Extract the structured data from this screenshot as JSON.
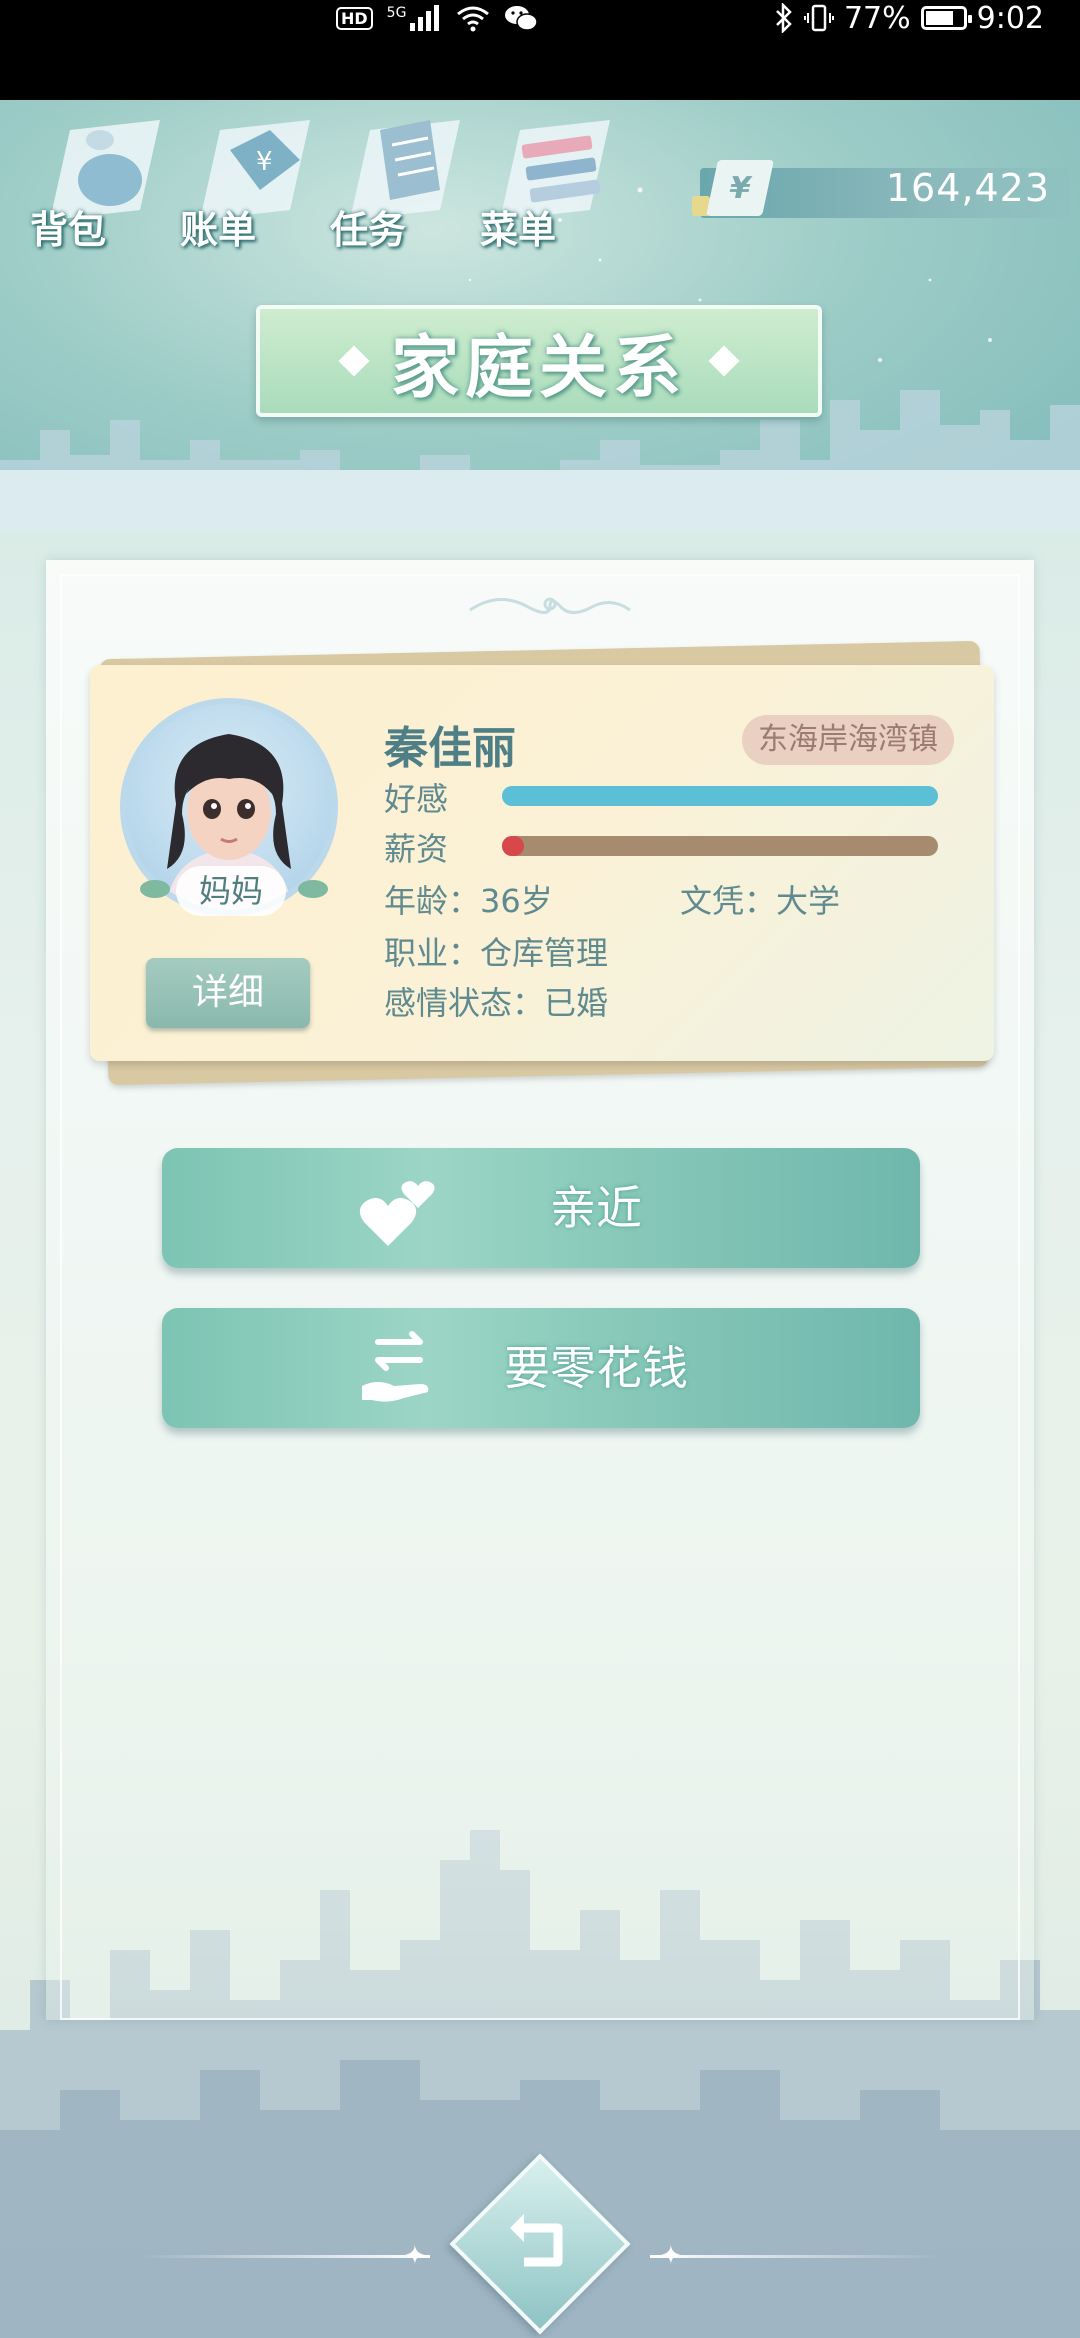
{
  "status_bar": {
    "hd_badge": "HD",
    "network": "5G",
    "battery_text": "77%",
    "battery_level": 0.77,
    "time": "9:02"
  },
  "top_menu": {
    "items": [
      {
        "label": "背包",
        "icon": "backpack-icon"
      },
      {
        "label": "账单",
        "icon": "bill-icon"
      },
      {
        "label": "任务",
        "icon": "task-icon"
      },
      {
        "label": "菜单",
        "icon": "menu-icon"
      }
    ]
  },
  "currency": {
    "symbol": "¥",
    "amount": "164,423"
  },
  "title": "家庭关系",
  "character": {
    "name": "秦佳丽",
    "relation": "妈妈",
    "location": "东海岸海湾镇",
    "affection_label": "好感",
    "affection_value": 1.0,
    "affection_color": "#5bbfd6",
    "salary_label": "薪资",
    "salary_value": 0.05,
    "salary_color": "#d8474a",
    "age": "年龄：36岁",
    "education": "文凭：大学",
    "occupation": "职业：仓库管理",
    "marital_status": "感情状态：已婚",
    "detail_button": "详细"
  },
  "actions": {
    "approach": {
      "label": "亲近",
      "icon": "hearts-icon"
    },
    "allowance": {
      "label": "要零花钱",
      "icon": "exchange-hand-icon"
    }
  },
  "navigation": {
    "back_icon": "back-icon"
  }
}
